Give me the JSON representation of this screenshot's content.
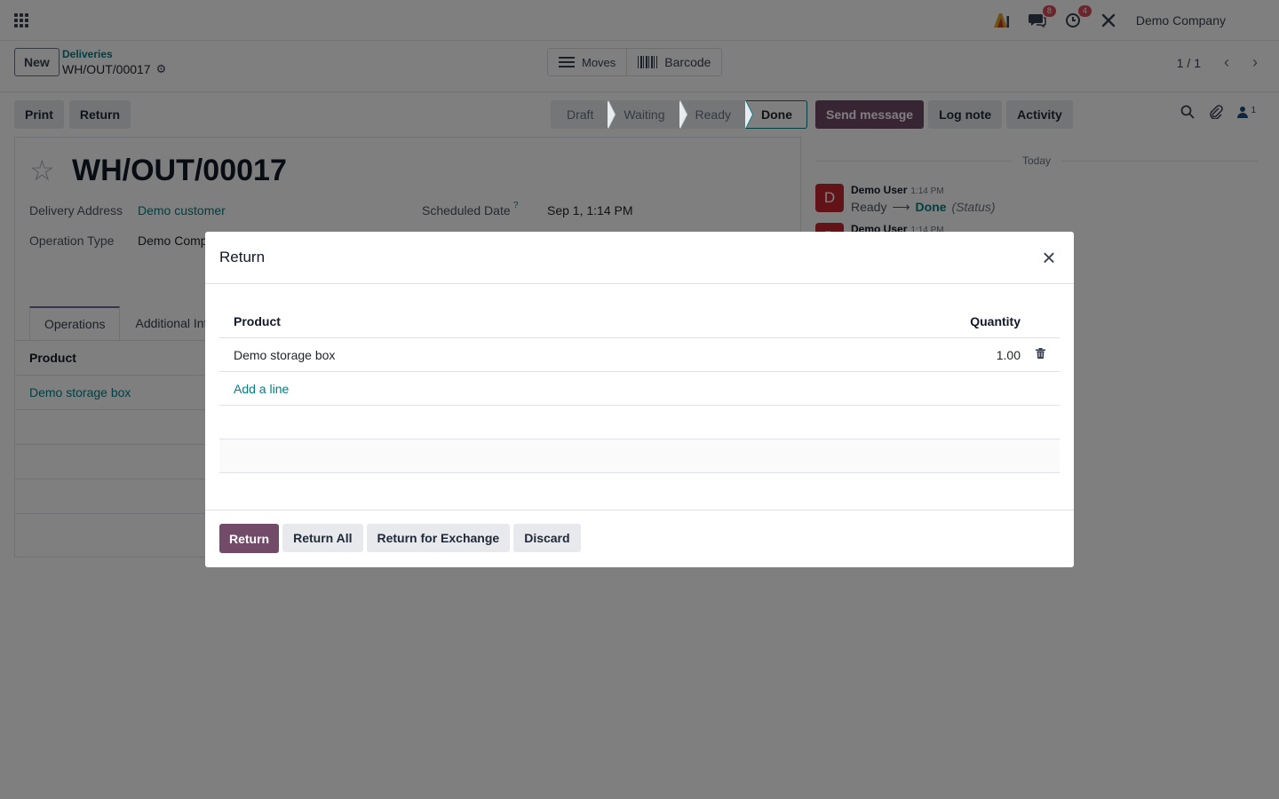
{
  "navbar": {
    "company": "Demo Company",
    "messages_count": "8",
    "activities_count": "4"
  },
  "control": {
    "new_label": "New",
    "breadcrumb_parent": "Deliveries",
    "breadcrumb_current": "WH/OUT/00017",
    "smart_moves": "Moves",
    "smart_barcode": "Barcode",
    "pager": "1 / 1"
  },
  "actions": {
    "print": "Print",
    "return": "Return"
  },
  "statusbar": {
    "stages": [
      "Draft",
      "Waiting",
      "Ready",
      "Done"
    ],
    "current": "Done"
  },
  "record": {
    "title": "WH/OUT/00017",
    "delivery_address_label": "Delivery Address",
    "delivery_address": "Demo customer",
    "operation_type_label": "Operation Type",
    "operation_type": "Demo Comp",
    "scheduled_date_label": "Scheduled Date",
    "scheduled_date_help": "?",
    "scheduled_date": "Sep 1, 1:14 PM",
    "tabs": [
      "Operations",
      "Additional Inf"
    ],
    "operations_header": "Product",
    "operations_rows": [
      "Demo storage box"
    ]
  },
  "chatter": {
    "send_message": "Send message",
    "log_note": "Log note",
    "activity": "Activity",
    "followers_count": "1",
    "today": "Today",
    "messages": [
      {
        "avatar": "D",
        "author": "Demo User",
        "time": "1:14 PM",
        "old": "Ready",
        "new": "Done",
        "field": "(Status)"
      },
      {
        "avatar": "D",
        "author": "Demo User",
        "time": "1:14 PM"
      }
    ]
  },
  "modal": {
    "title": "Return",
    "col_product": "Product",
    "col_quantity": "Quantity",
    "lines": [
      {
        "product": "Demo storage box",
        "quantity": "1.00"
      }
    ],
    "add_line": "Add a line",
    "btn_return": "Return",
    "btn_return_all": "Return All",
    "btn_return_exchange": "Return for Exchange",
    "btn_discard": "Discard"
  },
  "colors": {
    "primary": "#714b67",
    "link": "#017e84",
    "badge": "#d44c59",
    "avatar": "#c4262e"
  }
}
